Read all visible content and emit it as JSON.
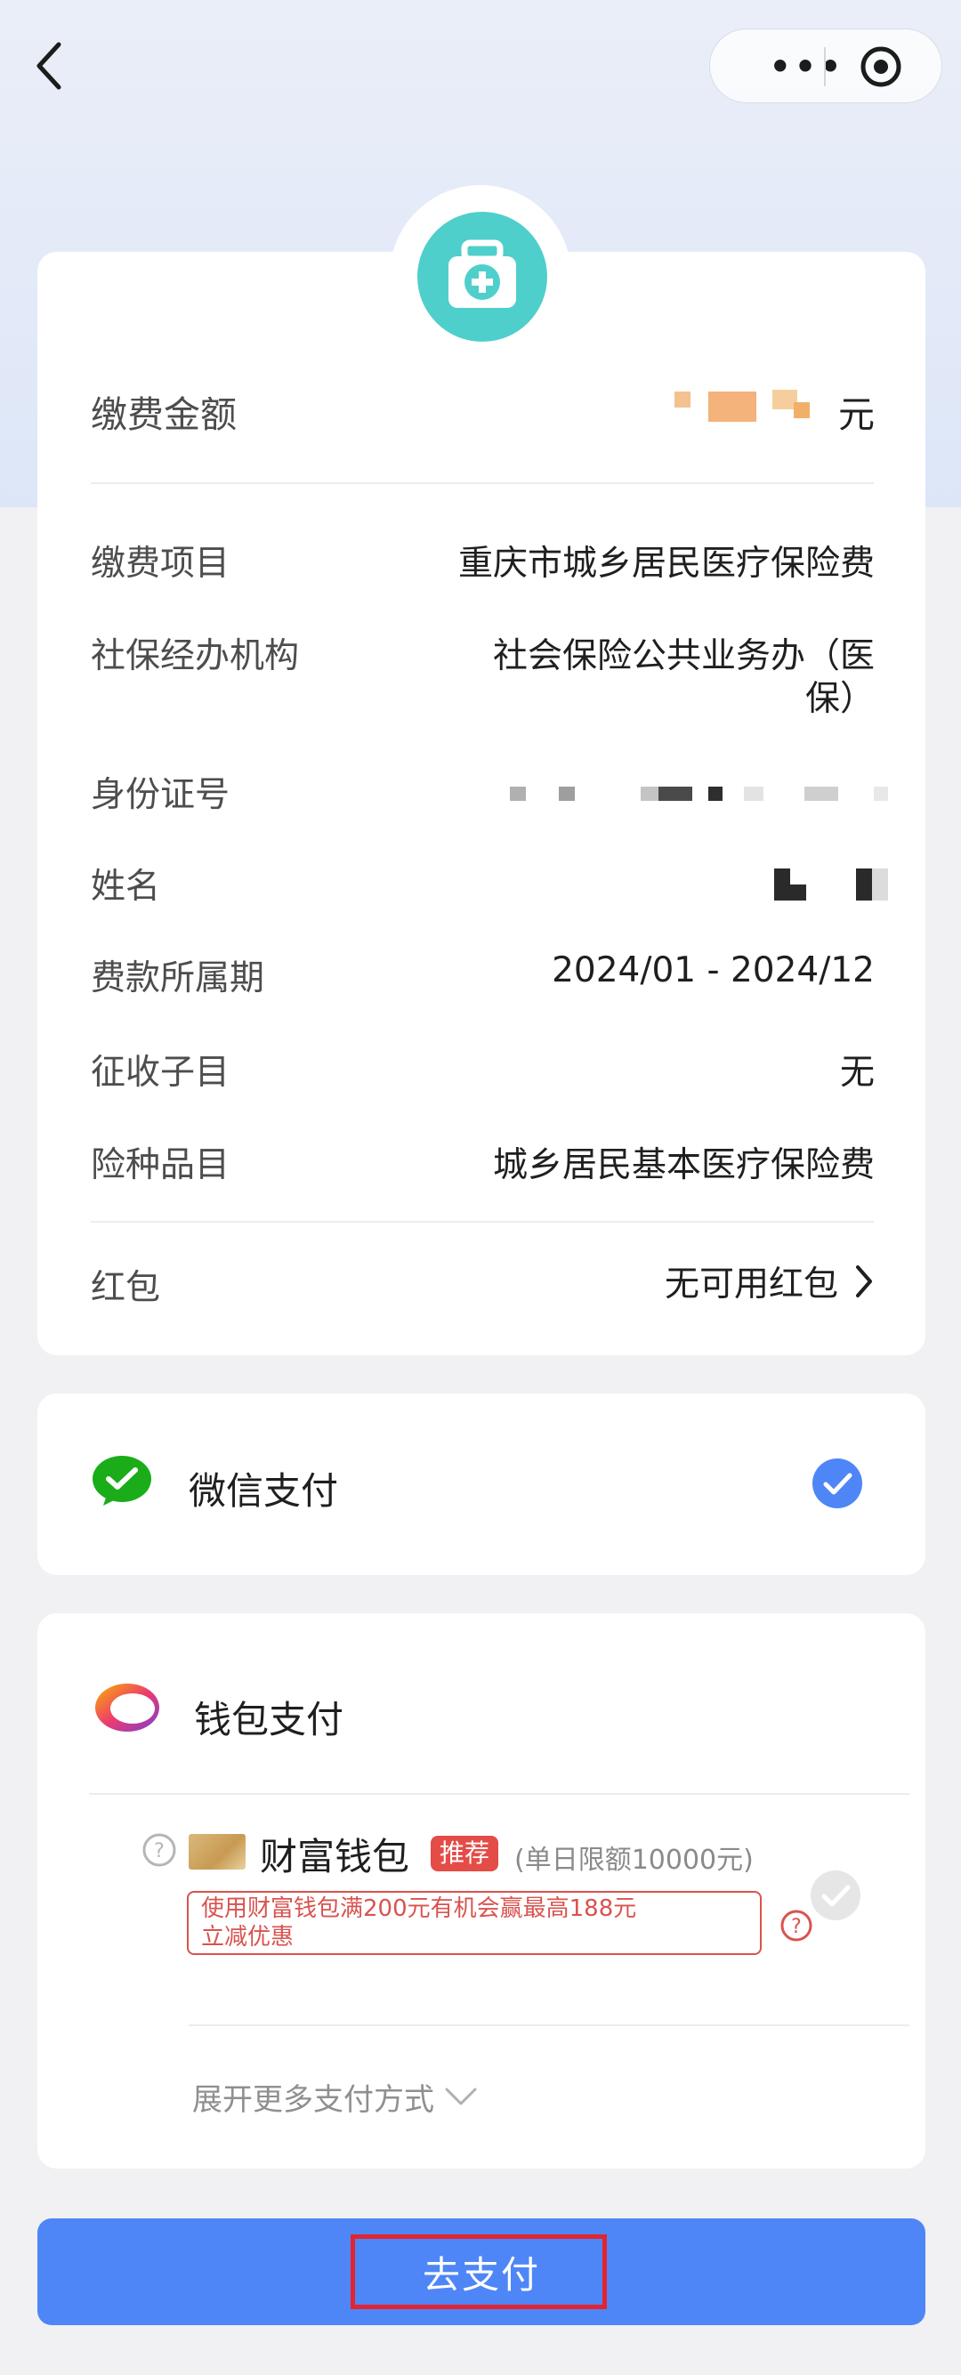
{
  "nav": {
    "more_glyph": "•••"
  },
  "summary": {
    "amount_label": "缴费金额",
    "amount_unit": "元",
    "rows": [
      {
        "label": "缴费项目",
        "value": "重庆市城乡居民医疗保险费"
      },
      {
        "label": "社保经办机构",
        "value_line1": "社会保险公共业务办（医",
        "value_line2": "保）"
      },
      {
        "label": "身份证号"
      },
      {
        "label": "姓名"
      },
      {
        "label": "费款所属期",
        "value": "2024/01 - 2024/12"
      },
      {
        "label": "征收子目",
        "value": "无"
      },
      {
        "label": "险种品目",
        "value": "城乡居民基本医疗保险费"
      }
    ],
    "redpacket_label": "红包",
    "redpacket_value": "无可用红包"
  },
  "wechat": {
    "label": "微信支付",
    "selected": true
  },
  "wallet": {
    "title": "钱包支付",
    "caifu_name": "财富钱包",
    "tag": "推荐",
    "limit": "(单日限额10000元)",
    "promo_line1": "使用财富钱包满200元有机会赢最高188元",
    "promo_line2": "立减优惠",
    "expand": "展开更多支付方式"
  },
  "pay_button": "去支付",
  "colors": {
    "accent": "#4f86f7",
    "wechat_green": "#1aad19",
    "tag_red": "#e44c47",
    "highlight": "#e3232d"
  }
}
